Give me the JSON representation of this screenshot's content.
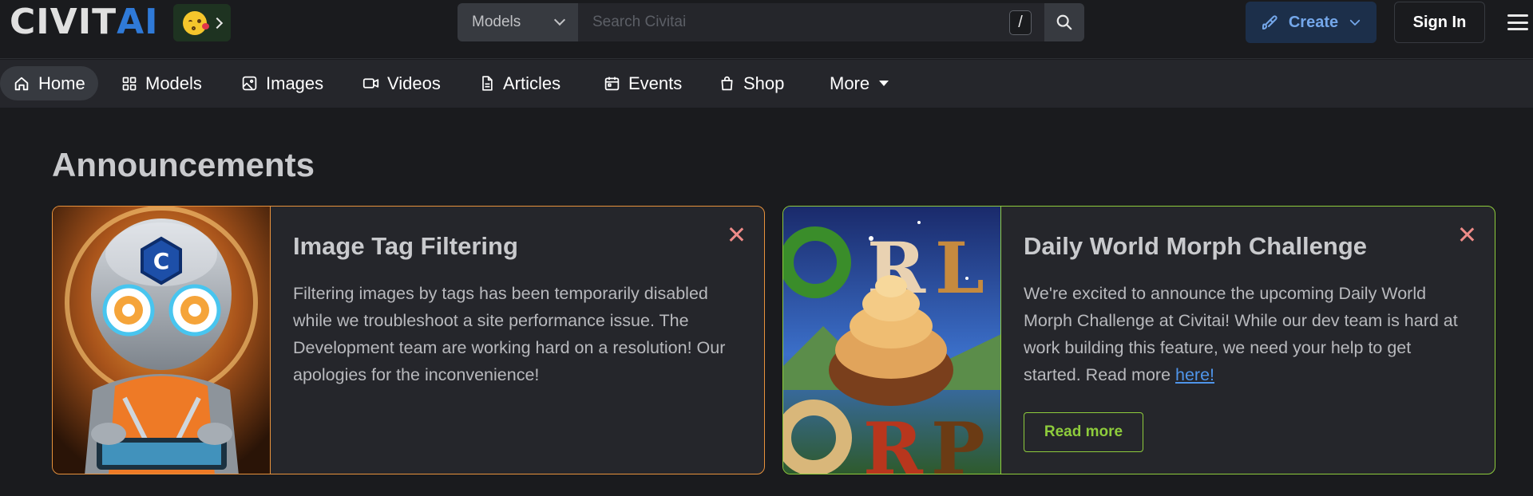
{
  "header": {
    "logo": {
      "part1": "CIVIT",
      "part2": "AI"
    },
    "emoji_icon": "kissing-face-emoji",
    "search": {
      "type_value": "Models",
      "placeholder": "Search Civitai",
      "shortcut": "/"
    },
    "create_label": "Create",
    "signin_label": "Sign In"
  },
  "nav": {
    "items": [
      {
        "label": "Home",
        "icon": "home-icon"
      },
      {
        "label": "Models",
        "icon": "grid-icon"
      },
      {
        "label": "Images",
        "icon": "photo-icon"
      },
      {
        "label": "Videos",
        "icon": "video-icon"
      },
      {
        "label": "Articles",
        "icon": "file-text-icon"
      },
      {
        "label": "Events",
        "icon": "calendar-icon"
      },
      {
        "label": "Shop",
        "icon": "shopping-bag-icon"
      },
      {
        "label": "More",
        "icon": "caret-down-icon"
      }
    ]
  },
  "main": {
    "title": "Announcements",
    "cards": [
      {
        "title": "Image Tag Filtering",
        "text": "Filtering images by tags has been temporarily disabled while we troubleshoot a site performance issue. The Development team are working hard on a resolution! Our apologies for the inconvenience!",
        "accent": "#e8923c"
      },
      {
        "title": "Daily World Morph Challenge",
        "text_before_link": "We're excited to announce the upcoming Daily World Morph Challenge at Civitai! While our dev team is hard at work building this feature, we need your help to get started. Read more ",
        "link_text": "here!",
        "button_label": "Read more",
        "accent": "#8ecc3c"
      }
    ]
  },
  "colors": {
    "background": "#1a1b1e",
    "nav_bg": "#25262b",
    "brand_blue": "#2f7ad8",
    "close_icon": "#ee8b88"
  }
}
